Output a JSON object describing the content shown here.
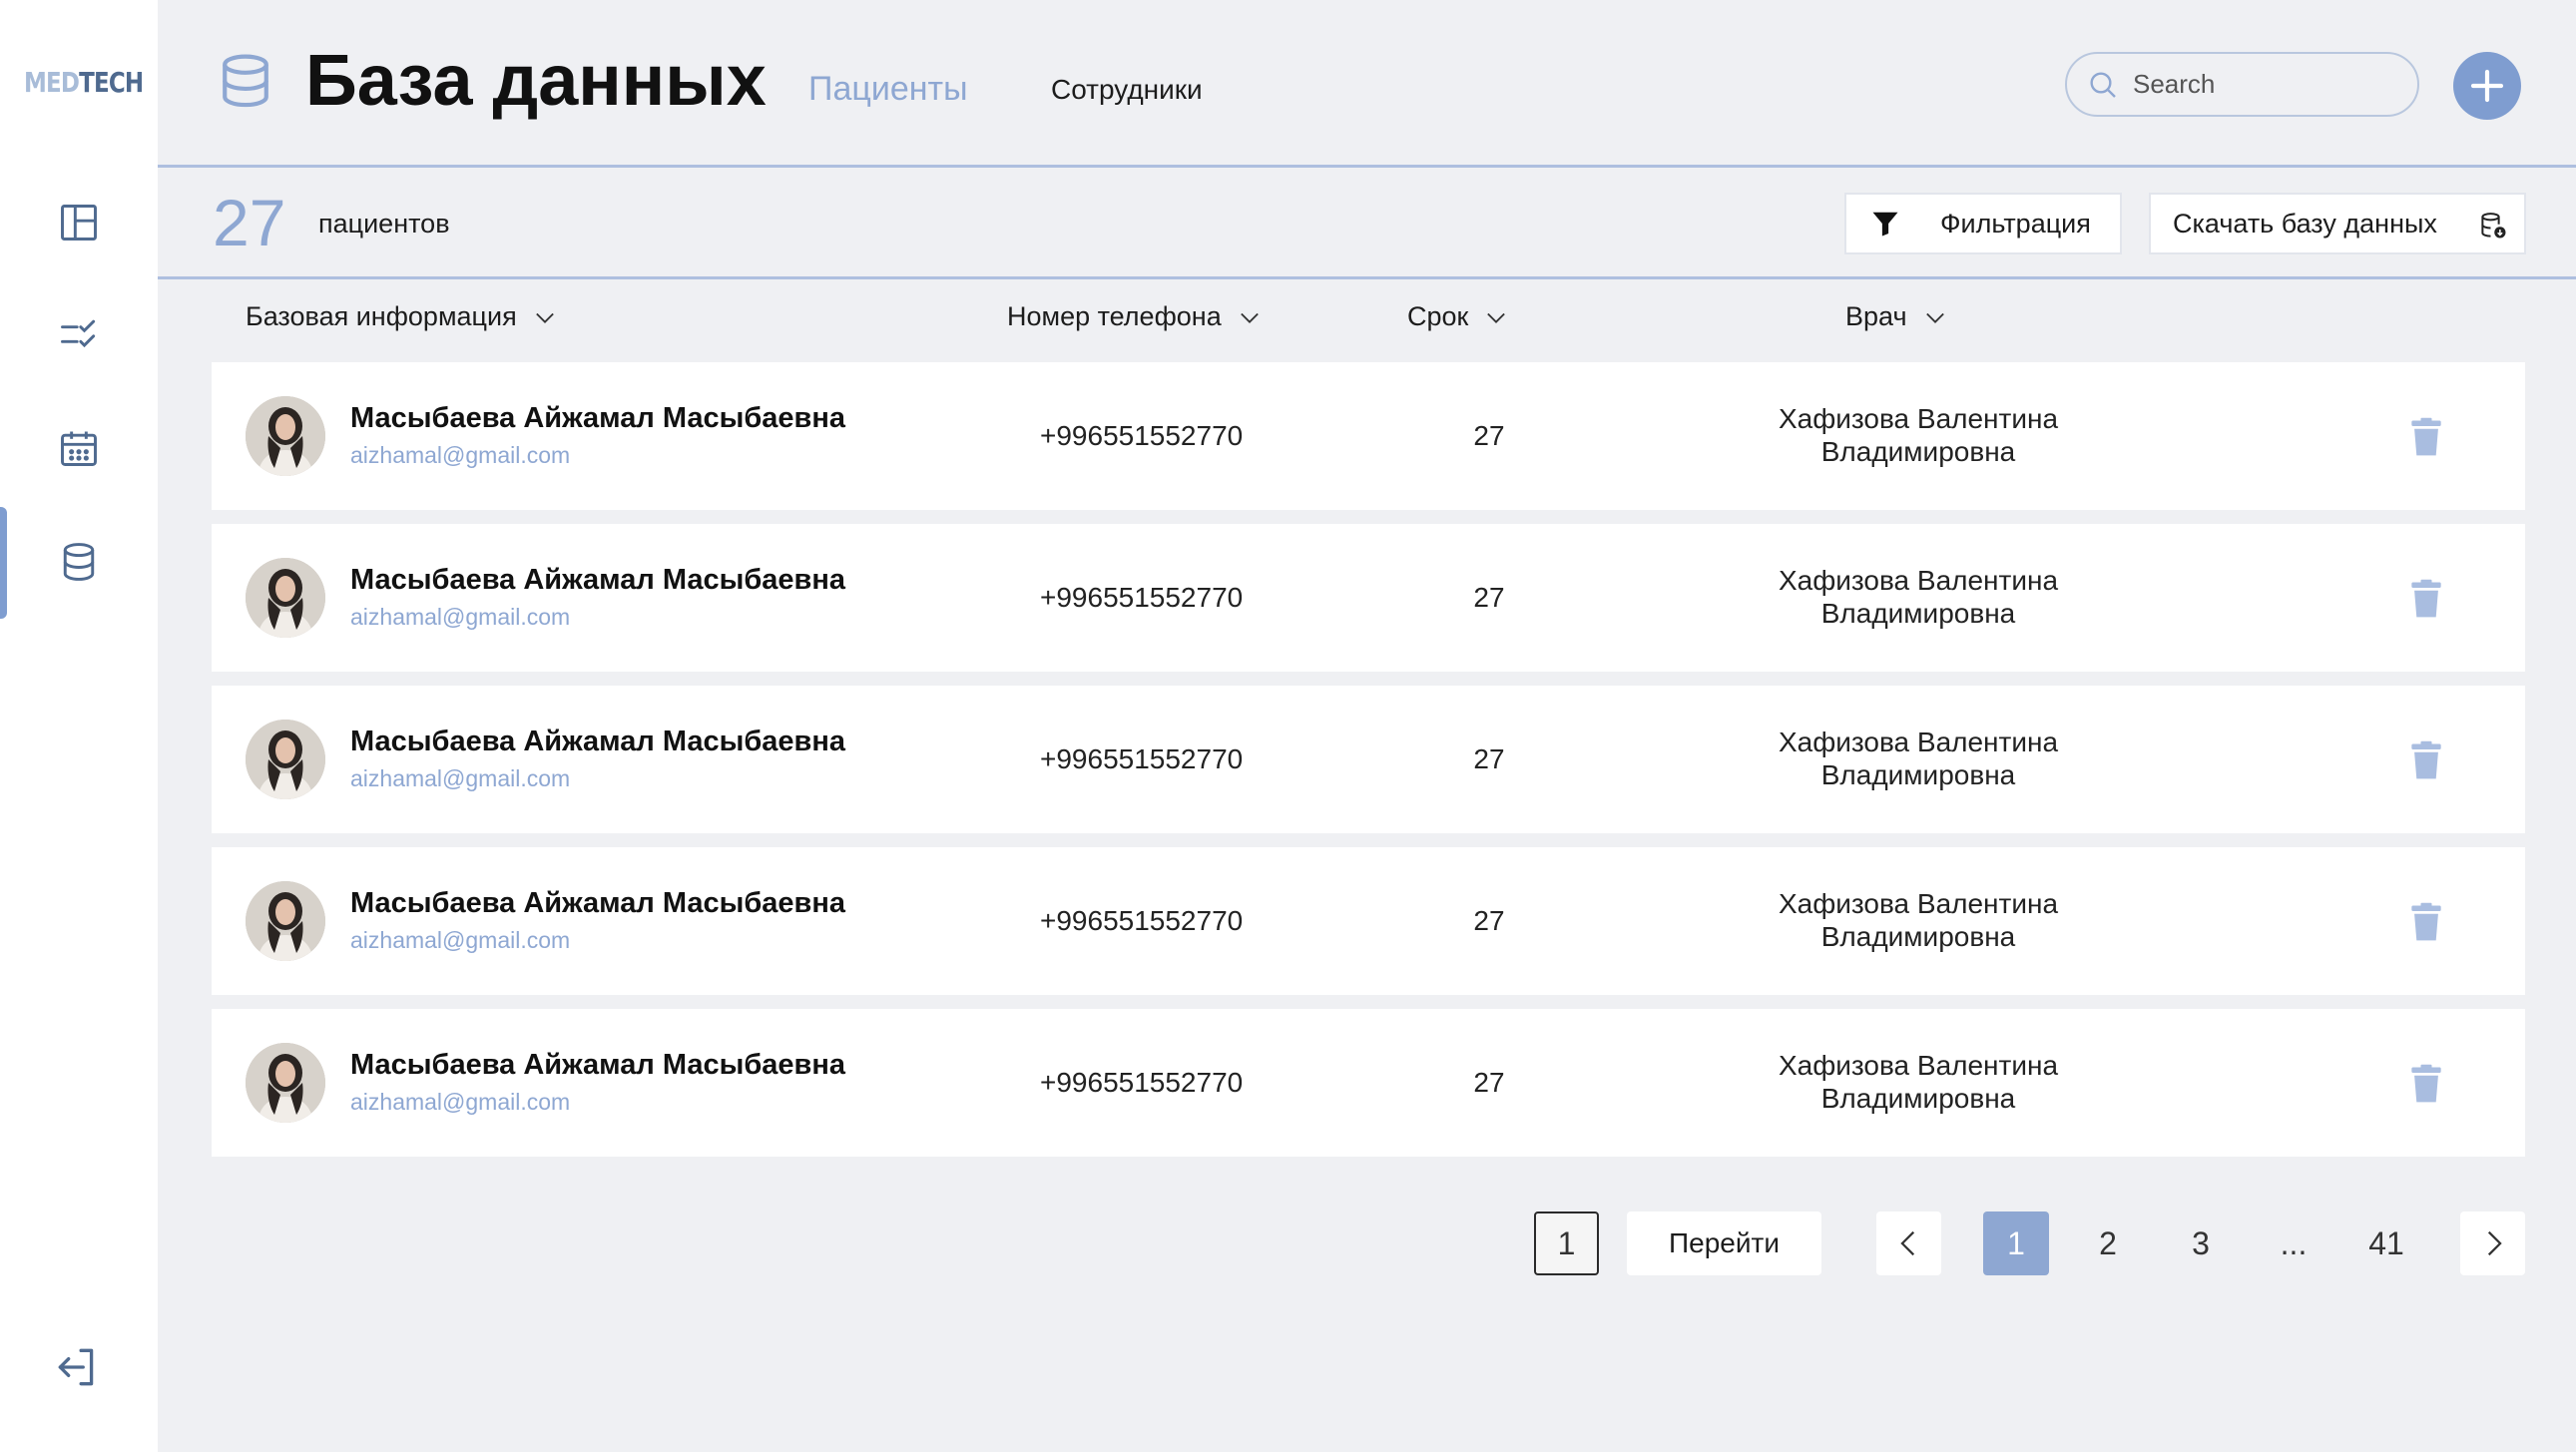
{
  "app": {
    "logo_part1": "MED",
    "logo_part2": "TECH"
  },
  "sidebar": {
    "items": [
      {
        "icon": "dashboard-icon"
      },
      {
        "icon": "checklist-icon"
      },
      {
        "icon": "calendar-icon"
      },
      {
        "icon": "database-icon",
        "active": true
      }
    ],
    "logout_icon": "logout-icon"
  },
  "header": {
    "title": "База данных",
    "tabs": [
      {
        "label": "Пациенты",
        "active": true
      },
      {
        "label": "Сотрудники",
        "active": false
      }
    ],
    "search_placeholder": "Search"
  },
  "summary": {
    "count": "27",
    "count_label": "пациентов",
    "filter_label": "Фильтрация",
    "download_label": "Скачать базу данных"
  },
  "table": {
    "headers": [
      "Базовая информация",
      "Номер телефона",
      "Срок",
      "Врач"
    ],
    "rows": [
      {
        "name": "Масыбаева Айжамал Масыбаевна",
        "email": "aizhamal@gmail.com",
        "phone": "+996551552770",
        "term": "27",
        "doctor_line1": "Хафизова Валентина",
        "doctor_line2": "Владимировна"
      },
      {
        "name": "Масыбаева Айжамал Масыбаевна",
        "email": "aizhamal@gmail.com",
        "phone": "+996551552770",
        "term": "27",
        "doctor_line1": "Хафизова Валентина",
        "doctor_line2": "Владимировна"
      },
      {
        "name": "Масыбаева Айжамал Масыбаевна",
        "email": "aizhamal@gmail.com",
        "phone": "+996551552770",
        "term": "27",
        "doctor_line1": "Хафизова Валентина",
        "doctor_line2": "Владимировна"
      },
      {
        "name": "Масыбаева Айжамал Масыбаевна",
        "email": "aizhamal@gmail.com",
        "phone": "+996551552770",
        "term": "27",
        "doctor_line1": "Хафизова Валентина",
        "doctor_line2": "Владимировна"
      },
      {
        "name": "Масыбаева Айжамал Масыбаевна",
        "email": "aizhamal@gmail.com",
        "phone": "+996551552770",
        "term": "27",
        "doctor_line1": "Хафизова Валентина",
        "doctor_line2": "Владимировна"
      }
    ]
  },
  "pagination": {
    "input_value": "1",
    "go_label": "Перейти",
    "pages": [
      "1",
      "2",
      "3",
      "...",
      "41"
    ],
    "current": "1"
  },
  "colors": {
    "accent": "#7f9dd0",
    "accent_light": "#8ea7d2",
    "background": "#eff0f3",
    "trash": "#a9bde0"
  }
}
